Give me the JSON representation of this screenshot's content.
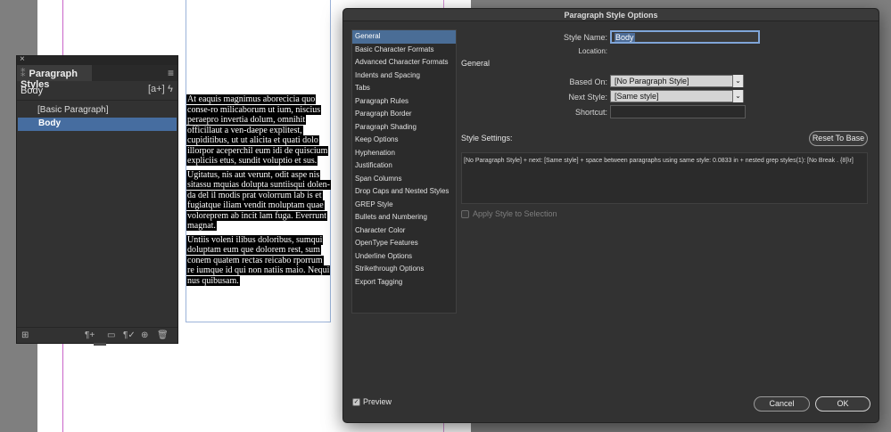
{
  "canvas": {
    "story": [
      "At eaquis magnimus aborecicia quo conse-ro milicaborum ut ium, niscius peraepro invertia dolum, omnihit officillaut a ven-daepe explitest, cupiditibus, ut ut alicita et quati dolo illorpor aceperchil eum idi de quiscium expliciis etus, sundit voluptio et sus.",
      "Ugitatus, nis aut verunt, odit aspe nis sitassu mquias dolupta suntiisqui dolen-da del il modis prat volorrum lab is et fugiatque iliam vendit moluptam quae voloreprem ab incit lam fuga. Everrunt magnat.",
      "Untiis voleni ilibus doloribus, sumqui doluptam eum que dolorem rest, sum conem quatem rectas reicabo rporrum re iumque id qui non natiis maio. Nequi nus quibusam."
    ]
  },
  "styles_panel": {
    "title": "Paragraph Styles",
    "current_style": "Body",
    "items": [
      {
        "label": "[Basic Paragraph]",
        "selected": false
      },
      {
        "label": "Body",
        "selected": true
      }
    ]
  },
  "dialog": {
    "title": "Paragraph Style Options",
    "categories": [
      "General",
      "Basic Character Formats",
      "Advanced Character Formats",
      "Indents and Spacing",
      "Tabs",
      "Paragraph Rules",
      "Paragraph Border",
      "Paragraph Shading",
      "Keep Options",
      "Hyphenation",
      "Justification",
      "Span Columns",
      "Drop Caps and Nested Styles",
      "GREP Style",
      "Bullets and Numbering",
      "Character Color",
      "OpenType Features",
      "Underline Options",
      "Strikethrough Options",
      "Export Tagging"
    ],
    "selected_category": "General",
    "style_name_label": "Style Name:",
    "style_name_value": "Body",
    "location_label": "Location:",
    "section_heading": "General",
    "based_on_label": "Based On:",
    "based_on_value": "[No Paragraph Style]",
    "next_style_label": "Next Style:",
    "next_style_value": "[Same style]",
    "shortcut_label": "Shortcut:",
    "shortcut_value": "",
    "settings_label": "Style Settings:",
    "reset_button": "Reset To Base",
    "settings_text": "[No Paragraph Style] + next: [Same style] + space between paragraphs using same style: 0.0833 in + nested grep styles(1): [No Break . {8}\\r]",
    "apply_label": "Apply Style to Selection",
    "apply_checked": false,
    "preview_label": "Preview",
    "preview_checked": true,
    "cancel_button": "Cancel",
    "ok_button": "OK"
  }
}
